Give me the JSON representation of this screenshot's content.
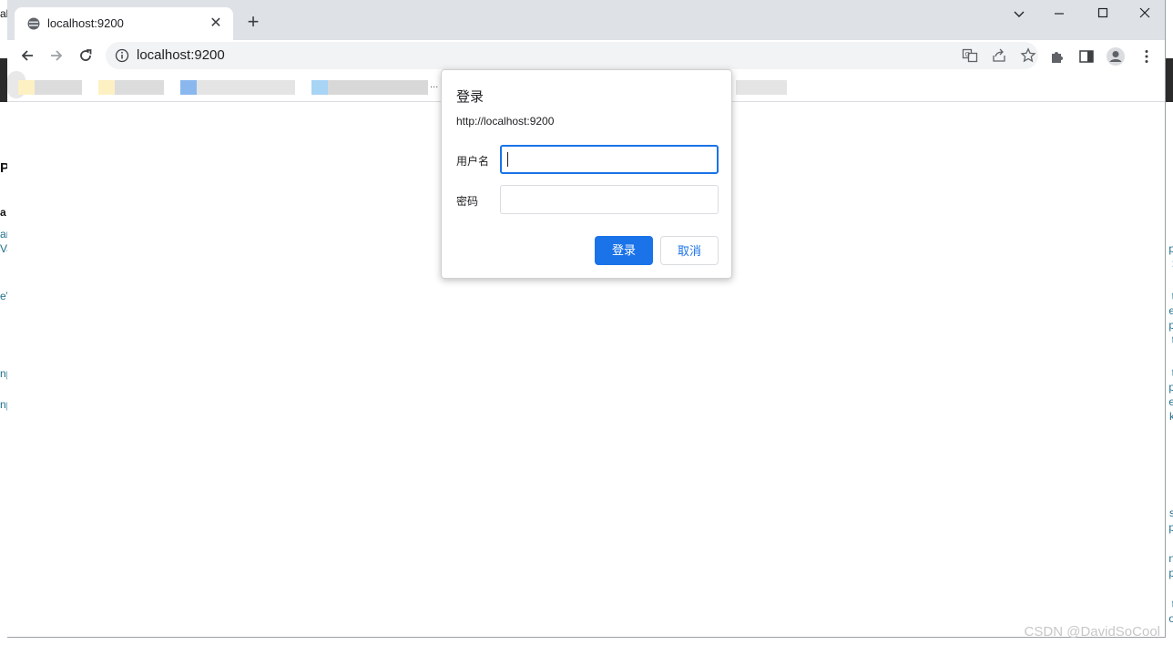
{
  "browser": {
    "tab_title": "localhost:9200",
    "url": "localhost:9200",
    "new_tab_symbol": "+",
    "close_symbol": "✕"
  },
  "dialog": {
    "title": "登录",
    "origin": "http://localhost:9200",
    "username_label": "用户名",
    "username_value": "",
    "password_label": "密码",
    "password_value": "",
    "login_button": "登录",
    "cancel_button": "取消"
  },
  "bookmarks_overflow": "...",
  "background_fragments": {
    "left": [
      "al",
      "P",
      "a",
      "ar",
      "Va",
      "eV",
      "np",
      "np"
    ],
    "right": [
      "p",
      ":",
      "t",
      "e",
      "p",
      "t",
      "t",
      "p",
      "e",
      "k",
      "s",
      "p",
      "n",
      "p",
      "t",
      "o"
    ]
  },
  "watermark": "CSDN @DavidSoCool",
  "colors": {
    "accent": "#1a73e8",
    "tabstrip": "#dee1e6",
    "omnibox": "#f1f3f4"
  }
}
